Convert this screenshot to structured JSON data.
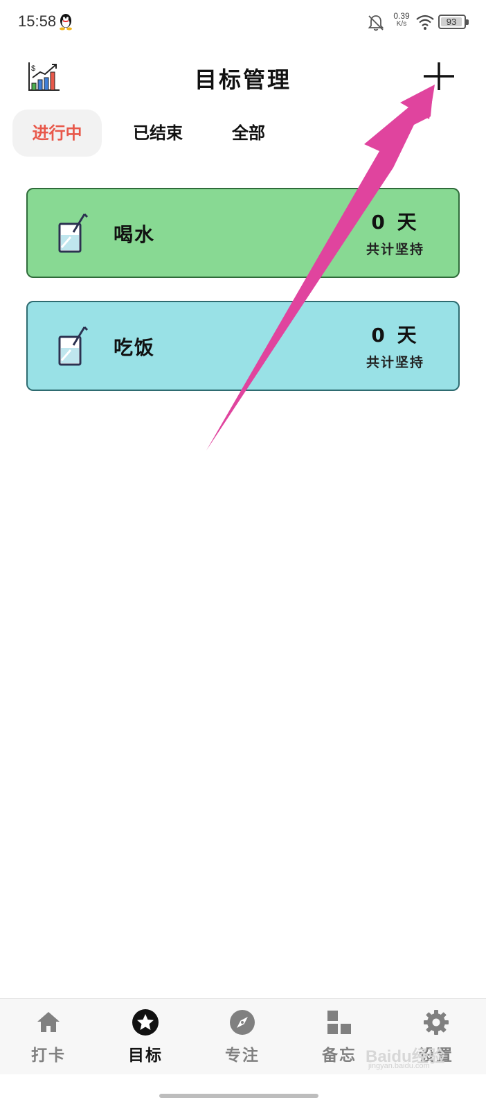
{
  "status_bar": {
    "time": "15:58",
    "net_speed_value": "0.39",
    "net_speed_unit": "K/s",
    "battery": "93"
  },
  "header": {
    "title": "目标管理"
  },
  "tabs": [
    {
      "label": "进行中",
      "active": true
    },
    {
      "label": "已结束",
      "active": false
    },
    {
      "label": "全部",
      "active": false
    }
  ],
  "goals": [
    {
      "name": "喝水",
      "days": "0 天",
      "subtitle": "共计坚持",
      "color": "#88d993"
    },
    {
      "name": "吃饭",
      "days": "0 天",
      "subtitle": "共计坚持",
      "color": "#99e1e6"
    }
  ],
  "bottom_nav": [
    {
      "label": "打卡",
      "icon": "home-icon",
      "active": false
    },
    {
      "label": "目标",
      "icon": "star-icon",
      "active": true
    },
    {
      "label": "专注",
      "icon": "compass-icon",
      "active": false
    },
    {
      "label": "备忘",
      "icon": "widgets-icon",
      "active": false
    },
    {
      "label": "设置",
      "icon": "gear-icon",
      "active": false
    }
  ],
  "watermark": {
    "text": "Baidu经验",
    "sub": "jingyan.baidu.com"
  },
  "colors": {
    "accent": "#e8584a",
    "annotation_arrow": "#e0449e"
  }
}
